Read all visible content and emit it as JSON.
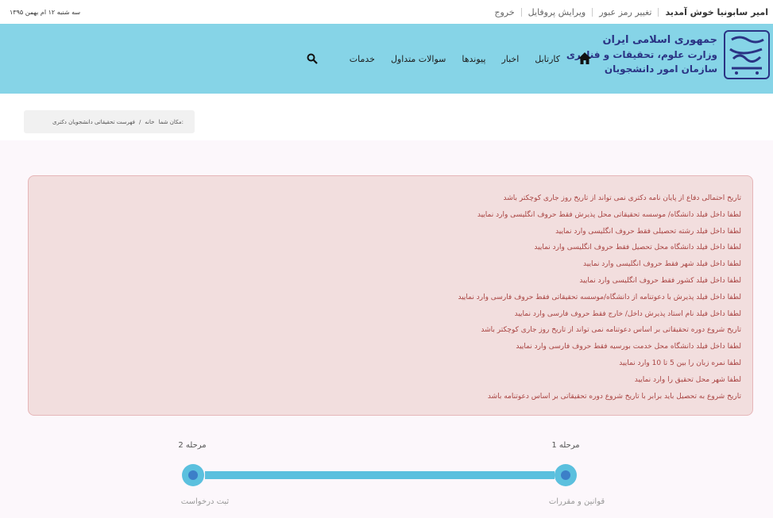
{
  "topbar": {
    "welcome": "امیر سابونیا خوش آمدید",
    "links": [
      "تغییر رمز عبور",
      "ویرایش پروفایل",
      "خروج"
    ],
    "date": "سه شنبه ۱۲ ام بهمن ۱۳۹۵"
  },
  "header": {
    "logo_emblem_text": "امور دانشجویان",
    "logo_lines": [
      "جمهوری اسلامی ایران",
      "وزارت علوم، تحقیقات و فناوری",
      "سازمان امور دانشجویان"
    ],
    "nav": [
      "کارتابل",
      "اخبار",
      "پیوندها",
      "سوالات متداول",
      "خدمات"
    ],
    "icons": {
      "home": "home-icon",
      "search": "search-icon"
    }
  },
  "breadcrumb": {
    "label": "مکان شما:",
    "home": "خانه",
    "separator": "/",
    "current": "فهرست تحقیقاتی دانشجویان دکتری"
  },
  "alert": {
    "messages": [
      "تاریخ احتمالی دفاع از پایان نامه دکتری نمی تواند از تاریخ روز جاری کوچکتر باشد",
      "لطفا داخل فیلد دانشگاه/ موسسه تحقیقاتی محل پذیرش فقط حروف انگلیسی وارد نمایید",
      "لطفا داخل فیلد رشته تحصیلی فقط حروف انگلیسی وارد نمایید",
      "لطفا داخل فیلد دانشگاه محل تحصیل فقط حروف انگلیسی وارد نمایید",
      "لطفا داخل فیلد شهر فقط حروف انگلیسی وارد نمایید",
      "لطفا داخل فیلد کشور فقط حروف انگلیسی وارد نمایید",
      "لطفا داخل فیلد پذیرش با دعوتنامه از دانشگاه/موسسه تحقیقاتی فقط حروف فارسی وارد نمایید",
      "لطفا داخل فیلد نام استاد پذیرش داخل/ خارج فقط حروف فارسی وارد نمایید",
      "تاریخ شروع دوره تحقیقاتی بر اساس دعوتنامه نمی تواند از تاریخ روز جاری کوچکتر باشد",
      "لطفا داخل فیلد دانشگاه محل خدمت بورسیه فقط حروف فارسی وارد نمایید",
      "لطفا نمره زبان را بین 5 تا 10 وارد نمایید",
      "لطفا شهر محل تحقیق را وارد نمایید",
      "تاریخ شروع به تحصیل باید برابر با تاریخ شروع دوره تحقیقاتی بر اساس دعوتنامه باشد"
    ]
  },
  "wizard": {
    "steps": [
      {
        "top": "مرحله 1",
        "bottom": "قوانین و مقررات"
      },
      {
        "top": "مرحله 2",
        "bottom": "ثبت درخواست"
      }
    ]
  },
  "colors": {
    "header_bg": "#86d4e7",
    "alert_bg": "#f2dede",
    "alert_text": "#a94442",
    "step_accent": "#5bc0de",
    "step_dot": "#3c7fc8"
  }
}
